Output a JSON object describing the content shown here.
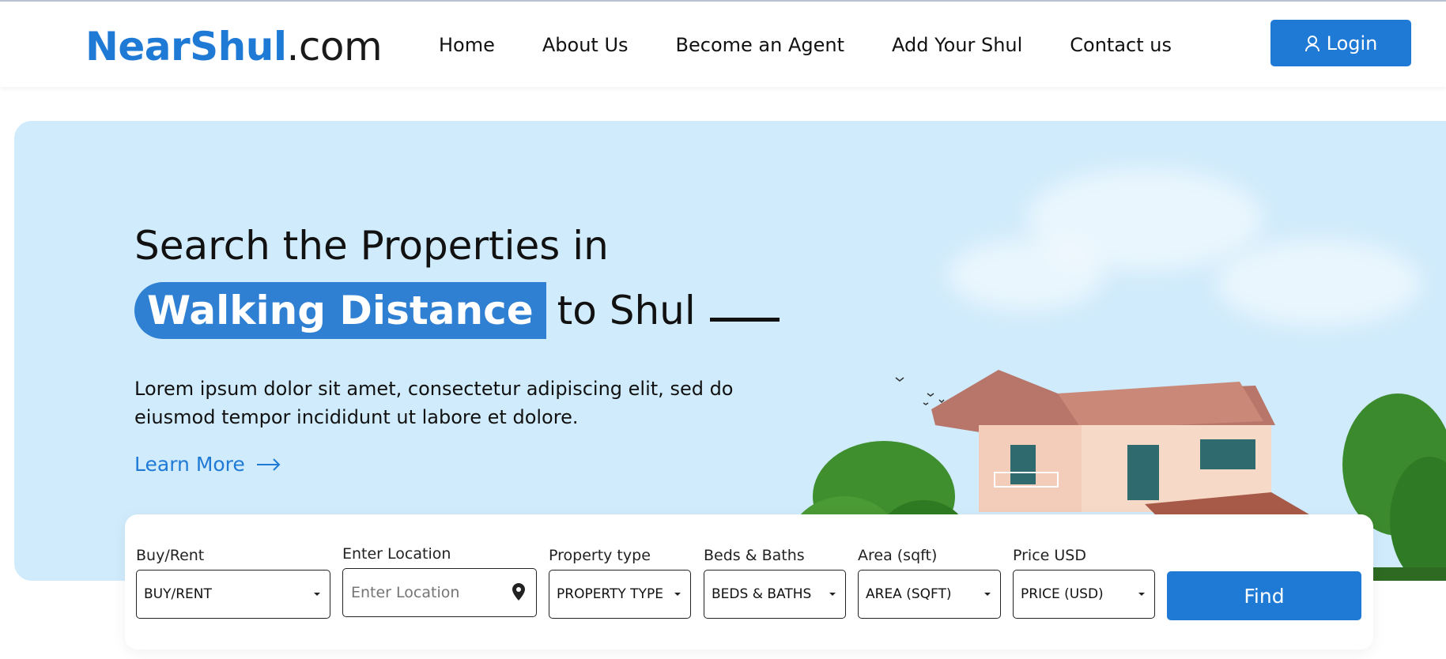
{
  "header": {
    "logo_brand": "NearShul",
    "logo_tld": ".com",
    "nav": [
      {
        "label": "Home"
      },
      {
        "label": "About Us"
      },
      {
        "label": "Become an Agent"
      },
      {
        "label": "Add Your Shul"
      },
      {
        "label": "Contact us"
      }
    ],
    "login_label": "Login"
  },
  "hero": {
    "title_line1": "Search the Properties in",
    "title_highlight": "Walking Distance",
    "title_rest": "to Shul",
    "description": "Lorem ipsum dolor sit amet, consectetur adipiscing elit, sed do eiusmod tempor incididunt ut labore et dolore.",
    "learn_more": "Learn More"
  },
  "search": {
    "buy_rent": {
      "label": "Buy/Rent",
      "value": "BUY/RENT"
    },
    "location": {
      "label": "Enter Location",
      "placeholder": "Enter Location"
    },
    "property_type": {
      "label": "Property type",
      "value": "PROPERTY TYPE"
    },
    "beds_baths": {
      "label": "Beds & Baths",
      "value": "BEDS & BATHS"
    },
    "area": {
      "label": "Area (sqft)",
      "value": "AREA (SQFT)"
    },
    "price": {
      "label": "Price USD",
      "value": "PRICE (USD)"
    },
    "find_label": "Find"
  },
  "colors": {
    "accent": "#1f7ad6",
    "hero_bg": "#d0ebfb"
  },
  "icons": [
    "user-icon",
    "arrow-right-icon",
    "map-pin-icon",
    "caret-down-icon"
  ]
}
